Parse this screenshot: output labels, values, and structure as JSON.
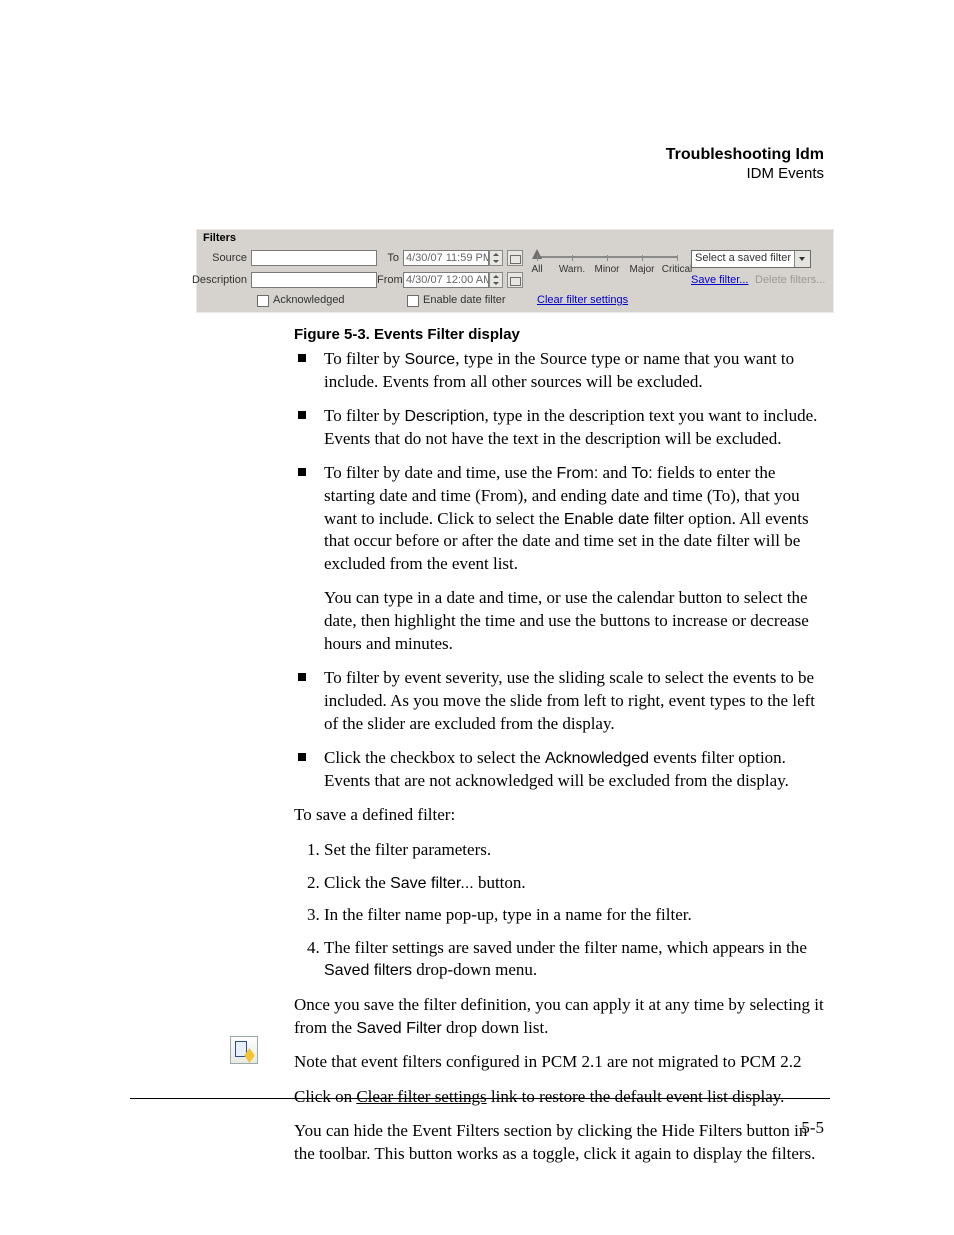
{
  "header": {
    "title": "Troubleshooting Idm",
    "subtitle": "IDM Events"
  },
  "figure": {
    "caption": "Figure 5-3. Events Filter display",
    "panel_title": "Filters",
    "source_label": "Source",
    "description_label": "Description",
    "to_label": "To",
    "from_label": "From",
    "to_value": "4/30/07 11:59 PM",
    "from_value": "4/30/07 12:00 AM",
    "ack_label": "Acknowledged",
    "enable_label": "Enable date filter",
    "clear_link": "Clear filter settings",
    "slider": [
      "All",
      "Warn.",
      "Minor",
      "Major",
      "Critical"
    ],
    "saved_placeholder": "Select a saved filter",
    "save_link": "Save filter...",
    "delete_link": "Delete filters..."
  },
  "bullets": {
    "b1a": "To filter by ",
    "b1_term": "Source",
    "b1b": ", type in the Source type or name that you want to include. Events from all other sources will be excluded.",
    "b2a": "To filter by ",
    "b2_term": "Description",
    "b2b": ", type in the description text you want to include. Events that do not have the text in the description will be excluded.",
    "b3a": "To filter by date and time, use the ",
    "b3_from": "From:",
    "b3b": " and ",
    "b3_to": "To:",
    "b3c": " fields to enter the starting date and time (From), and ending date and time (To), that you want to include. Click to select the ",
    "b3_enable": "Enable date filter",
    "b3d": " option. All events that occur before or after the date and time set in the date filter will be excluded from the event list.",
    "b3_sub": "You can type in a date and time, or use the calendar button to select the date, then highlight the time and use the buttons to increase or decrease hours and minutes.",
    "b4": "To filter by event severity, use the sliding scale to select the events to be included. As you move the slide from left to right, event types to the left of the slider are excluded from the display.",
    "b5a": "Click the checkbox to select the ",
    "b5_term": "Acknowledged",
    "b5b": " events filter option. Events that are not acknowledged will be excluded from the display."
  },
  "save_intro": "To save a defined filter:",
  "steps": {
    "s1": "Set the filter parameters.",
    "s2a": "Click the ",
    "s2_term": "Save filter...",
    "s2b": " button.",
    "s3": "In the filter name pop-up, type in a name for the filter.",
    "s4a": "The filter settings are saved under the filter name, which appears in the ",
    "s4_term": "Saved filters",
    "s4b": " drop-down menu."
  },
  "p_after1a": "Once you save the filter definition, you can apply it at any time by selecting it from the ",
  "p_after1_term": "Saved Filter",
  "p_after1b": " drop down list.",
  "p_after2": "Note that event filters configured in PCM 2.1 are not migrated to PCM 2.2",
  "p_after3a": "Click on ",
  "p_after3_link": "Clear filter settings",
  "p_after3b": " link to restore the default event list display.",
  "p_after4": "You can hide the Event Filters section by clicking the Hide Filters button in the toolbar. This button works as a toggle, click it again to display the filters.",
  "page_number": "5-5"
}
